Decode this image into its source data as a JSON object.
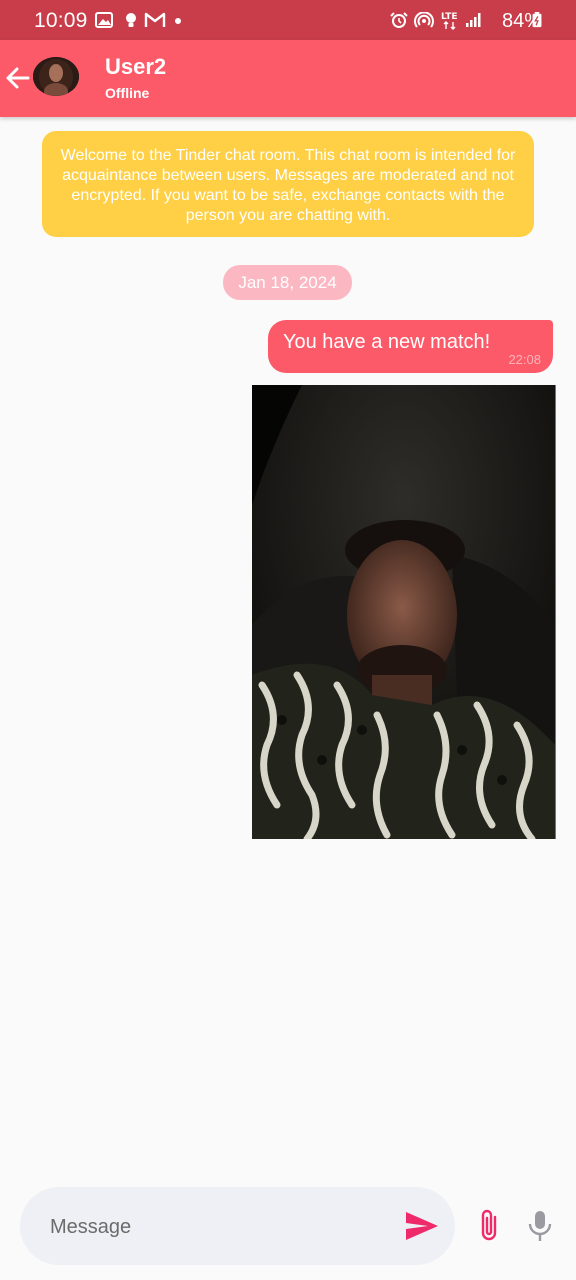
{
  "status_bar": {
    "time": "10:09",
    "battery": "84%",
    "network": "LTE"
  },
  "header": {
    "username": "User2",
    "status": "Offline"
  },
  "notice": {
    "text": "Welcome to the Tinder chat room. This chat room is intended for acquaintance between users. Messages are moderated and not encrypted. If you want to be safe, exchange contacts with the person you are chatting with."
  },
  "chat": {
    "date": "Jan 18, 2024",
    "messages": [
      {
        "text": "You have a new match!",
        "time": "22:08"
      }
    ]
  },
  "composer": {
    "placeholder": "Message"
  },
  "colors": {
    "accent": "#fc5a68",
    "status_bar": "#c83d49",
    "notice": "#ffd045",
    "date_chip": "#fbb8c2",
    "send_icon": "#ee2a6b",
    "mic_icon": "#9a9aa0"
  },
  "icons": [
    "gallery-icon",
    "bulb-icon",
    "gmail-icon",
    "alarm-icon",
    "hotspot-icon",
    "lte-icon",
    "signal-icon",
    "battery-icon",
    "back-arrow-icon",
    "send-icon",
    "attach-icon",
    "mic-icon"
  ]
}
